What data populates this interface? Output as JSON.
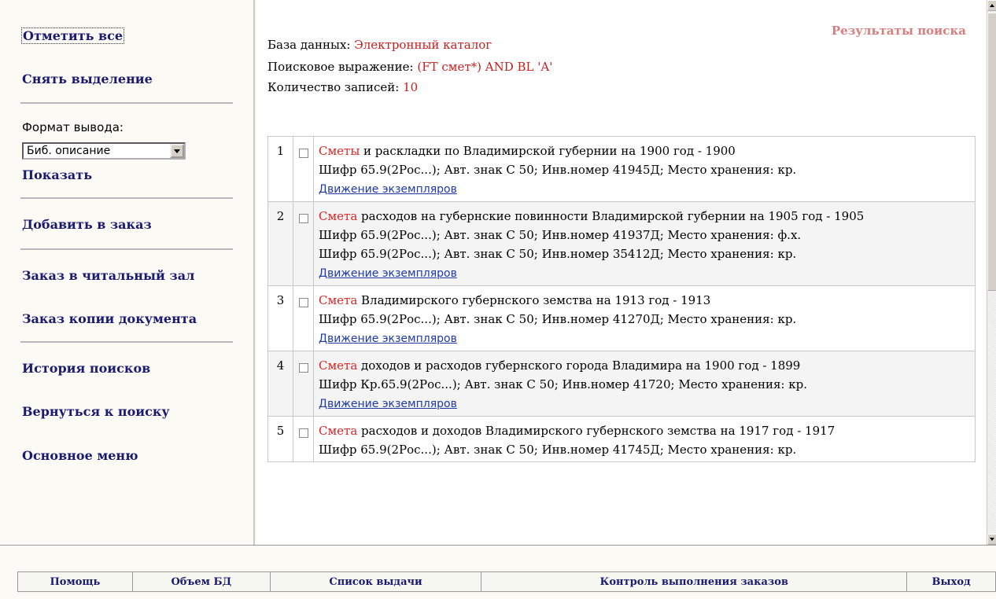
{
  "sidebar": {
    "mark_all": "Отметить все",
    "clear_selection": "Снять выделение",
    "format_label": "Формат вывода:",
    "format_selected": "Биб. описание",
    "show": "Показать",
    "add_to_order": "Добавить в заказ",
    "reading_room_order": "Заказ в читальный зал",
    "copy_order": "Заказ копии документа",
    "search_history": "История поисков",
    "back_to_search": "Вернуться к поиску",
    "main_menu": "Основное меню"
  },
  "main": {
    "heading": "Результаты поиска",
    "database_label": "База данных: ",
    "database_value": "Электронный каталог",
    "query_label": "Поисковое выражение: ",
    "query_value": "(FT смет*) AND BL 'A'",
    "count_label": "Количество записей: ",
    "count_value": "10"
  },
  "records": [
    {
      "num": "1",
      "highlight": "Сметы",
      "title_rest": " и раскладки по Владимирской губернии на 1900 год - 1900",
      "holdings": [
        "Шифр 65.9(2Рос...); Авт. знак С 50; Инв.номер 41945Д; Место хранения: кр."
      ],
      "link": "Движение экземпляров"
    },
    {
      "num": "2",
      "highlight": "Смета",
      "title_rest": " расходов на губернские повинности Владимирской губернии на 1905 год - 1905",
      "holdings": [
        "Шифр 65.9(2Рос...); Авт. знак С 50; Инв.номер 41937Д; Место хранения: ф.х.",
        "Шифр 65.9(2Рос...); Авт. знак С 50; Инв.номер 35412Д; Место хранения: кр."
      ],
      "link": "Движение экземпляров"
    },
    {
      "num": "3",
      "highlight": "Смета",
      "title_rest": " Владимирского губернского земства на 1913 год - 1913",
      "holdings": [
        "Шифр 65.9(2Рос...); Авт. знак С 50; Инв.номер 41270Д; Место хранения: кр."
      ],
      "link": "Движение экземпляров"
    },
    {
      "num": "4",
      "highlight": "Смета",
      "title_rest": " доходов и расходов губернского города Владимира на 1900 год - 1899",
      "holdings": [
        "Шифр Кр.65.9(2Рос...); Авт. знак С 50; Инв.номер 41720; Место хранения: кр."
      ],
      "link": "Движение экземпляров"
    },
    {
      "num": "5",
      "highlight": "Смета",
      "title_rest": " расходов и доходов Владимирского губернского земства на 1917 год - 1917",
      "holdings": [
        "Шифр 65.9(2Рос...); Авт. знак С 50; Инв.номер 41745Д; Место хранения: кр."
      ],
      "link": ""
    }
  ],
  "bottom_menu": [
    "Помощь",
    "Объем БД",
    "Список выдачи",
    "Контроль выполнения заказов",
    "Выход"
  ]
}
